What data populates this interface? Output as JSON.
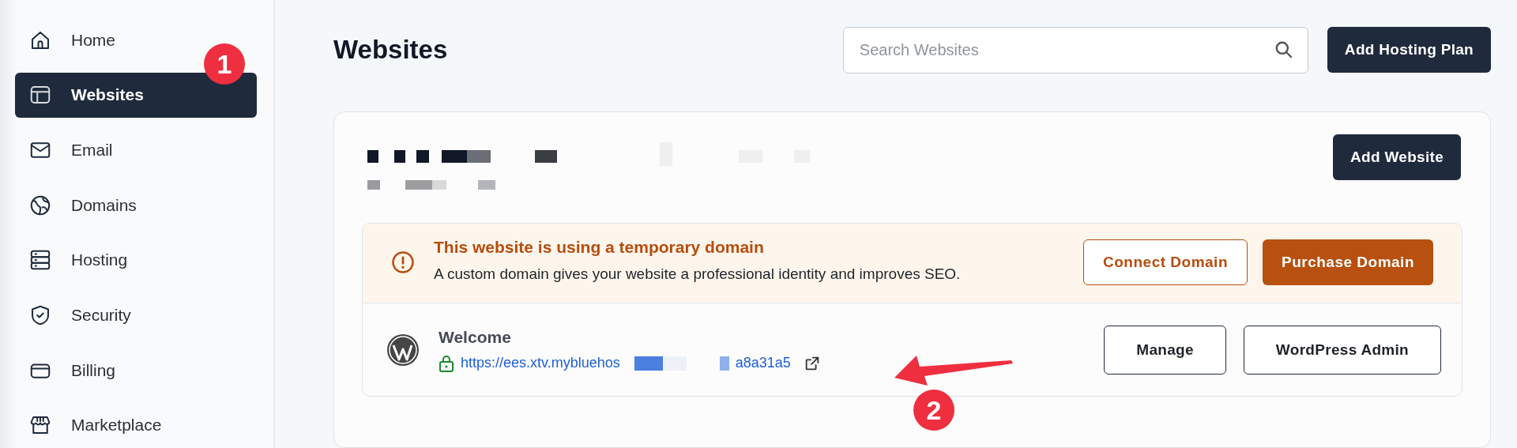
{
  "sidebar": {
    "items": [
      {
        "label": "Home",
        "selected": false
      },
      {
        "label": "Websites",
        "selected": true
      },
      {
        "label": "Email",
        "selected": false
      },
      {
        "label": "Domains",
        "selected": false
      },
      {
        "label": "Hosting",
        "selected": false
      },
      {
        "label": "Security",
        "selected": false
      },
      {
        "label": "Billing",
        "selected": false
      },
      {
        "label": "Marketplace",
        "selected": false
      }
    ]
  },
  "header": {
    "title": "Websites",
    "search": {
      "placeholder": "Search Websites"
    },
    "button": "Add Hosting Plan"
  },
  "card": {
    "button": "Add Website",
    "notice": {
      "title": "This website is using a temporary domain",
      "text": "A custom domain gives your website a professional identity and improves SEO.",
      "buttons": [
        {
          "label": "Connect Domain",
          "kind": "outline"
        },
        {
          "label": "Purchase Domain",
          "kind": "filled"
        }
      ]
    },
    "site": {
      "name": "Welcome",
      "url_start": "https://ees.xtv.mybluehos",
      "url_end": "a8a31a5",
      "buttons": [
        "Manage",
        "WordPress Admin"
      ]
    }
  },
  "annotations": [
    {
      "label": "1"
    },
    {
      "label": "2"
    }
  ]
}
